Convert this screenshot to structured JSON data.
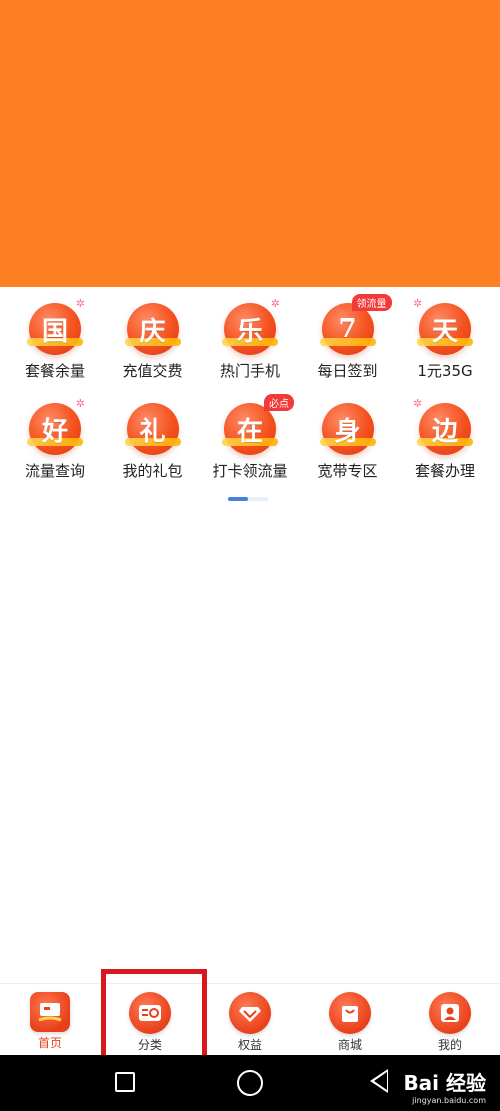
{
  "colors": {
    "banner": "#ff7f24",
    "accent": "#e8401b",
    "pager_active": "#4a7fe0",
    "highlight": "#d6181f"
  },
  "grid": {
    "rows": [
      [
        {
          "glyph": "国",
          "label": "套餐余量",
          "tag": ""
        },
        {
          "glyph": "庆",
          "label": "充值交费",
          "tag": ""
        },
        {
          "glyph": "乐",
          "label": "热门手机",
          "tag": ""
        },
        {
          "glyph": "7",
          "label": "每日签到",
          "tag": "领流量"
        },
        {
          "glyph": "天",
          "label": "1元35G",
          "tag": ""
        }
      ],
      [
        {
          "glyph": "好",
          "label": "流量查询",
          "tag": ""
        },
        {
          "glyph": "礼",
          "label": "我的礼包",
          "tag": ""
        },
        {
          "glyph": "在",
          "label": "打卡领流量",
          "tag": "必点"
        },
        {
          "glyph": "身",
          "label": "宽带专区",
          "tag": ""
        },
        {
          "glyph": "边",
          "label": "套餐办理",
          "tag": ""
        }
      ]
    ]
  },
  "pager": {
    "pages": 2,
    "active": 1
  },
  "tabbar": {
    "tabs": [
      {
        "label": "首页",
        "icon": "home-icon",
        "active": true
      },
      {
        "label": "分类",
        "icon": "category-icon",
        "active": false
      },
      {
        "label": "权益",
        "icon": "diamond-icon",
        "active": false
      },
      {
        "label": "商城",
        "icon": "shopping-bag-icon",
        "active": false
      },
      {
        "label": "我的",
        "icon": "profile-icon",
        "active": false
      }
    ]
  },
  "watermark": {
    "main": "Bai 经验",
    "sub": "jingyan.baidu.com"
  }
}
